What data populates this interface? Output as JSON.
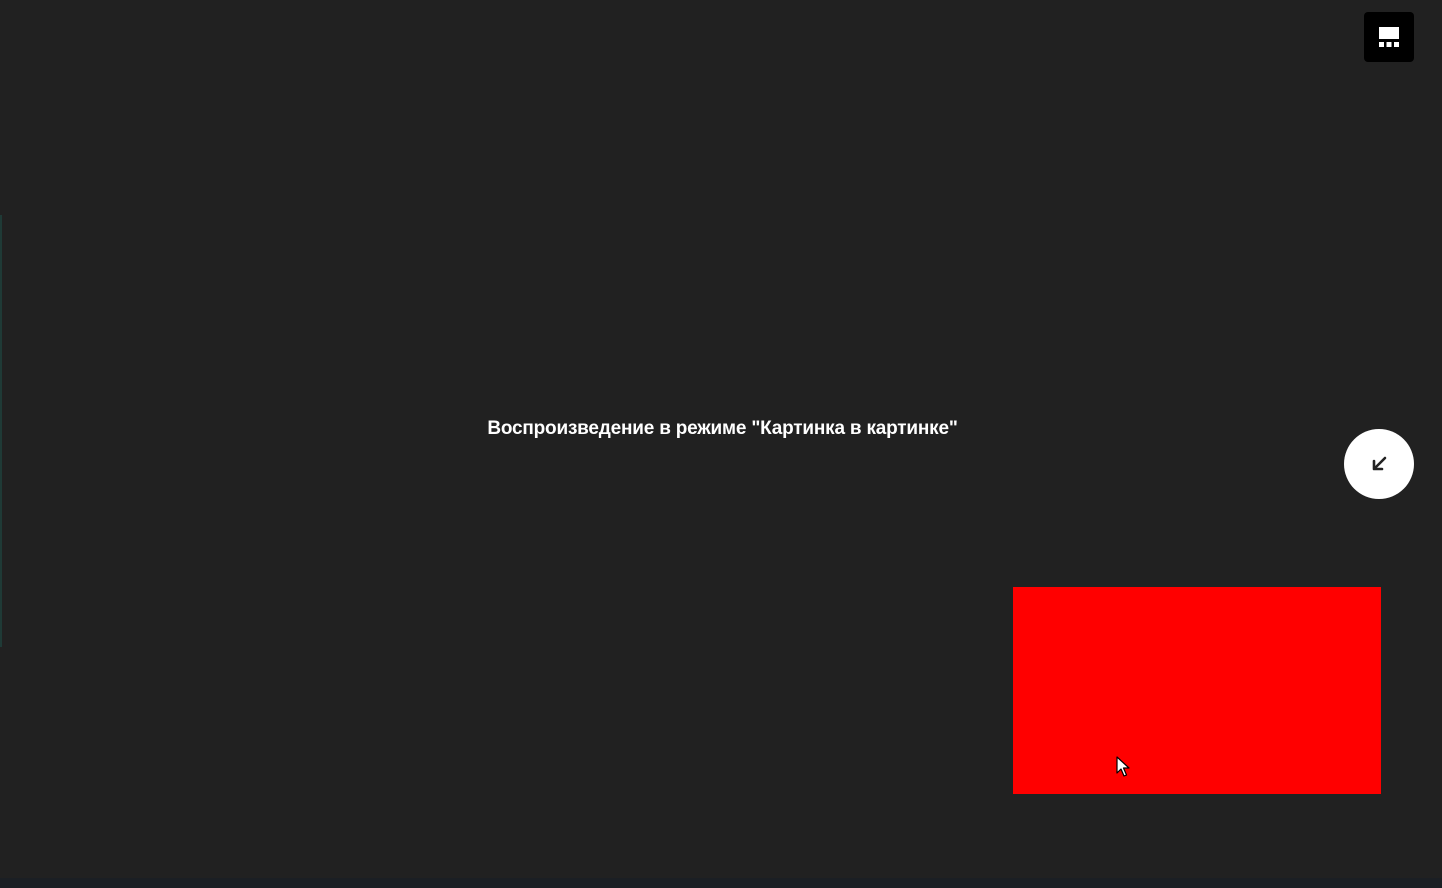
{
  "player": {
    "message": "Воспроизведение в режиме \"Картинка в картинке\""
  },
  "controls": {
    "top_right_icon": "picture-in-picture-icon",
    "return_icon": "arrow-down-left-icon",
    "cursor_icon": "mouse-pointer-icon"
  },
  "colors": {
    "background": "#212121",
    "pip_window": "#ff0000",
    "button_dark": "#000000",
    "button_light": "#ffffff"
  }
}
